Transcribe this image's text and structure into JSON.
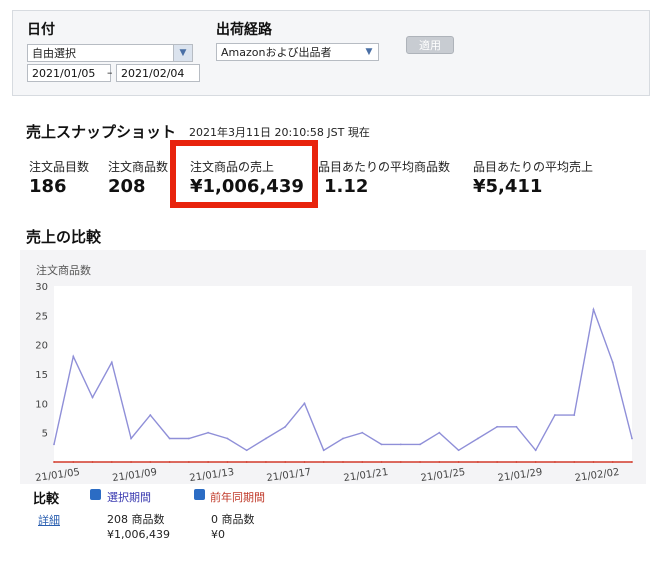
{
  "filters": {
    "date_label": "日付",
    "date_mode": "自由選択",
    "date_from": "2021/01/05",
    "date_sep": "–",
    "date_to": "2021/02/04",
    "channel_label": "出荷経路",
    "channel_value": "Amazonおよび出品者",
    "apply_label": "適用"
  },
  "snapshot": {
    "title": "売上スナップショット",
    "timestamp": "2021年3月11日 20:10:58 JST 現在",
    "metrics": [
      {
        "label": "注文品目数",
        "value": "186"
      },
      {
        "label": "注文商品数",
        "value": "208"
      },
      {
        "label": "注文商品の売上",
        "value": "¥1,006,439"
      },
      {
        "label": "品目あたりの平均商品数",
        "value": "1.12"
      },
      {
        "label": "品目あたりの平均売上",
        "value": "¥5,411"
      }
    ]
  },
  "comparison": {
    "title": "売上の比較",
    "compare_label": "比較",
    "detail_link": "詳細",
    "selected_label": "選択期間",
    "selected_units": "208 商品数",
    "selected_sales": "¥1,006,439",
    "prior_label": "前年同期間",
    "prior_units": "0 商品数",
    "prior_sales": "¥0"
  },
  "colors": {
    "selected": "#8f8fd8",
    "prior": "#d23a2a",
    "highlight": "#e8230d"
  },
  "chart_data": {
    "type": "line",
    "ylabel": "注文商品数",
    "ylim": [
      0,
      30
    ],
    "yticks": [
      5,
      10,
      15,
      20,
      25,
      30
    ],
    "xtick_labels": [
      "21/01/05",
      "21/01/09",
      "21/01/13",
      "21/01/17",
      "21/01/21",
      "21/01/25",
      "21/01/29",
      "21/02/02"
    ],
    "series": [
      {
        "name": "選択期間",
        "values": [
          3,
          18,
          11,
          17,
          4,
          8,
          4,
          4,
          5,
          4,
          2,
          4,
          6,
          10,
          2,
          4,
          5,
          3,
          3,
          3,
          5,
          2,
          4,
          6,
          6,
          2,
          8,
          8,
          26,
          17,
          4
        ]
      },
      {
        "name": "前年同期間",
        "values": [
          0,
          0,
          0,
          0,
          0,
          0,
          0,
          0,
          0,
          0,
          0,
          0,
          0,
          0,
          0,
          0,
          0,
          0,
          0,
          0,
          0,
          0,
          0,
          0,
          0,
          0,
          0,
          0,
          0,
          0,
          0
        ]
      }
    ]
  }
}
